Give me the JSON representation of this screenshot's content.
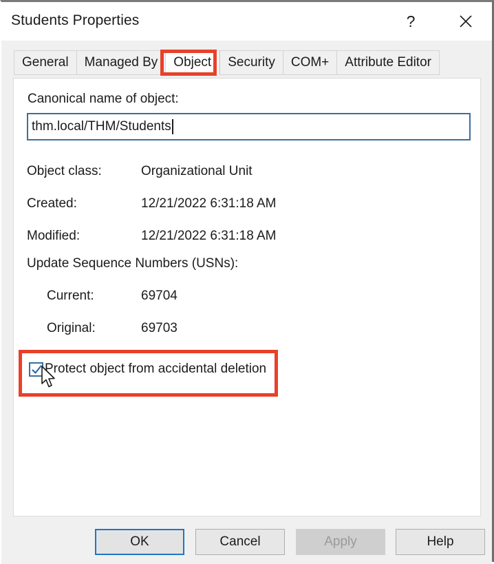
{
  "window": {
    "title": "Students Properties",
    "help_icon": "question-mark-icon",
    "close_icon": "close-x-icon"
  },
  "tabs": [
    {
      "label": "General",
      "active": false
    },
    {
      "label": "Managed By",
      "active": false
    },
    {
      "label": "Object",
      "active": true
    },
    {
      "label": "Security",
      "active": false
    },
    {
      "label": "COM+",
      "active": false
    },
    {
      "label": "Attribute Editor",
      "active": false
    }
  ],
  "object_tab": {
    "canonical_name_label": "Canonical name of object:",
    "canonical_name_value": "thm.local/THM/Students",
    "properties": [
      {
        "label": "Object class:",
        "value": "Organizational Unit"
      },
      {
        "label": "Created:",
        "value": "12/21/2022 6:31:18 AM"
      },
      {
        "label": "Modified:",
        "value": "12/21/2022 6:31:18 AM"
      }
    ],
    "usn_heading": "Update Sequence Numbers (USNs):",
    "usn_rows": [
      {
        "label": "Current:",
        "value": "69704"
      },
      {
        "label": "Original:",
        "value": "69703"
      }
    ],
    "protect_checkbox": {
      "label": "Protect object from accidental deletion",
      "checked": true,
      "icon": "checkmark-icon"
    }
  },
  "buttons": {
    "ok": "OK",
    "cancel": "Cancel",
    "apply": "Apply",
    "help": "Help"
  },
  "annotations": {
    "highlight_color": "#e8412a",
    "targets": [
      "object-tab",
      "protect-object-from-accidental-deletion-checkbox"
    ]
  },
  "colors": {
    "accent_blue": "#1c76c8",
    "field_border_blue": "#3d6e99",
    "dialog_background": "#f0f0f0",
    "panel_background": "#ffffff",
    "text": "#1b1b1b",
    "disabled_text": "#9a9a9a"
  },
  "cursor": {
    "type": "arrow-pointer"
  }
}
